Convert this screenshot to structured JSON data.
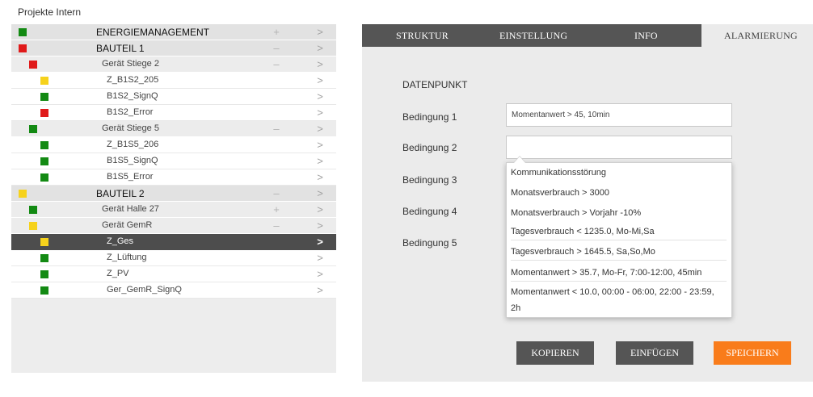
{
  "app": {
    "title": "Projekte Intern"
  },
  "colors": {
    "green": "#138a13",
    "red": "#e01a1a",
    "yellow": "#f6d21c",
    "accent_orange": "#f97c1b",
    "dark_button": "#555555"
  },
  "tree": {
    "rows": [
      {
        "label": "ENERGIEMANAGEMENT",
        "status": "green",
        "toggle": "+",
        "arrow": ">"
      },
      {
        "label": "BAUTEIL 1",
        "status": "red",
        "toggle": "–",
        "arrow": ">"
      },
      {
        "label": "Gerät Stiege 2",
        "status": "red",
        "toggle": "–",
        "arrow": ">"
      },
      {
        "label": "Z_B1S2_205",
        "status": "yellow",
        "toggle": "",
        "arrow": ">"
      },
      {
        "label": "B1S2_SignQ",
        "status": "green",
        "toggle": "",
        "arrow": ">"
      },
      {
        "label": "B1S2_Error",
        "status": "red",
        "toggle": "",
        "arrow": ">"
      },
      {
        "label": "Gerät Stiege 5",
        "status": "green",
        "toggle": "–",
        "arrow": ">"
      },
      {
        "label": "Z_B1S5_206",
        "status": "green",
        "toggle": "",
        "arrow": ">"
      },
      {
        "label": "B1S5_SignQ",
        "status": "green",
        "toggle": "",
        "arrow": ">"
      },
      {
        "label": "B1S5_Error",
        "status": "green",
        "toggle": "",
        "arrow": ">"
      },
      {
        "label": "BAUTEIL 2",
        "status": "yellow",
        "toggle": "–",
        "arrow": ">"
      },
      {
        "label": "Gerät Halle 27",
        "status": "green",
        "toggle": "+",
        "arrow": ">"
      },
      {
        "label": "Gerät GemR",
        "status": "yellow",
        "toggle": "–",
        "arrow": ">"
      },
      {
        "label": "Z_Ges",
        "status": "yellow",
        "toggle": "",
        "arrow": ">",
        "selected": true
      },
      {
        "label": "Z_Lüftung",
        "status": "green",
        "toggle": "",
        "arrow": ">"
      },
      {
        "label": "Z_PV",
        "status": "green",
        "toggle": "",
        "arrow": ">"
      },
      {
        "label": "Ger_GemR_SignQ",
        "status": "green",
        "toggle": "",
        "arrow": ">"
      }
    ]
  },
  "tabs": [
    {
      "label": "STRUKTUR"
    },
    {
      "label": "EINSTELLUNG"
    },
    {
      "label": "INFO"
    },
    {
      "label": "ALARMIERUNG",
      "active": true
    }
  ],
  "form": {
    "section_label": "DATENPUNKT",
    "conditions": [
      {
        "label": "Bedingung 1",
        "value": "Momentanwert > 45, 10min"
      },
      {
        "label": "Bedingung 2",
        "value": ""
      },
      {
        "label": "Bedingung 3"
      },
      {
        "label": "Bedingung 4"
      },
      {
        "label": "Bedingung 5"
      }
    ]
  },
  "dropdown": {
    "options": [
      "Kommunikationsstörung",
      "Monatsverbrauch > 3000",
      "Monatsverbrauch > Vorjahr -10%",
      "Tagesverbrauch < 1235.0, Mo-Mi,Sa",
      "Tagesverbrauch > 1645.5, Sa,So,Mo",
      "Momentanwert > 35.7, Mo-Fr, 7:00-12:00, 45min",
      "Momentanwert < 10.0, 00:00 - 06:00, 22:00 - 23:59,",
      "2h"
    ]
  },
  "buttons": {
    "copy": "KOPIEREN",
    "paste": "EINFÜGEN",
    "save": "SPEICHERN"
  }
}
